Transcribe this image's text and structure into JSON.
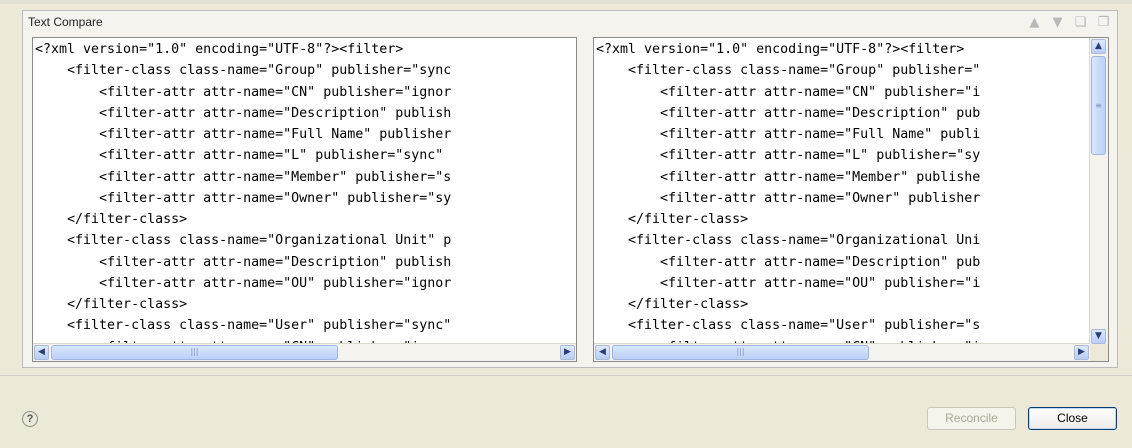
{
  "panel": {
    "title": "Text Compare",
    "toolbar_icons": [
      "next-difference-icon",
      "previous-difference-icon",
      "copy-all-left-icon",
      "copy-all-right-icon"
    ]
  },
  "left_pane": {
    "lines": [
      "<?xml version=\"1.0\" encoding=\"UTF-8\"?><filter>",
      "    <filter-class class-name=\"Group\" publisher=\"sync",
      "        <filter-attr attr-name=\"CN\" publisher=\"ignor",
      "        <filter-attr attr-name=\"Description\" publish",
      "        <filter-attr attr-name=\"Full Name\" publisher",
      "        <filter-attr attr-name=\"L\" publisher=\"sync\" ",
      "        <filter-attr attr-name=\"Member\" publisher=\"s",
      "        <filter-attr attr-name=\"Owner\" publisher=\"sy",
      "    </filter-class>",
      "    <filter-class class-name=\"Organizational Unit\" p",
      "        <filter-attr attr-name=\"Description\" publish",
      "        <filter-attr attr-name=\"OU\" publisher=\"ignor",
      "    </filter-class>",
      "    <filter-class class-name=\"User\" publisher=\"sync\"",
      "        <filter-attr attr-name=\"CN\" publisher=\"ignor"
    ]
  },
  "right_pane": {
    "lines": [
      "<?xml version=\"1.0\" encoding=\"UTF-8\"?><filter>",
      "    <filter-class class-name=\"Group\" publisher=\"",
      "        <filter-attr attr-name=\"CN\" publisher=\"i",
      "        <filter-attr attr-name=\"Description\" pub",
      "        <filter-attr attr-name=\"Full Name\" publi",
      "        <filter-attr attr-name=\"L\" publisher=\"sy",
      "        <filter-attr attr-name=\"Member\" publishe",
      "        <filter-attr attr-name=\"Owner\" publisher",
      "    </filter-class>",
      "    <filter-class class-name=\"Organizational Uni",
      "        <filter-attr attr-name=\"Description\" pub",
      "        <filter-attr attr-name=\"OU\" publisher=\"i",
      "    </filter-class>",
      "    <filter-class class-name=\"User\" publisher=\"s",
      "        <filter-attr attr-name=\"CN\" publisher=\"i"
    ]
  },
  "buttons": {
    "help": "?",
    "reconcile": "Reconcile",
    "close": "Close"
  }
}
